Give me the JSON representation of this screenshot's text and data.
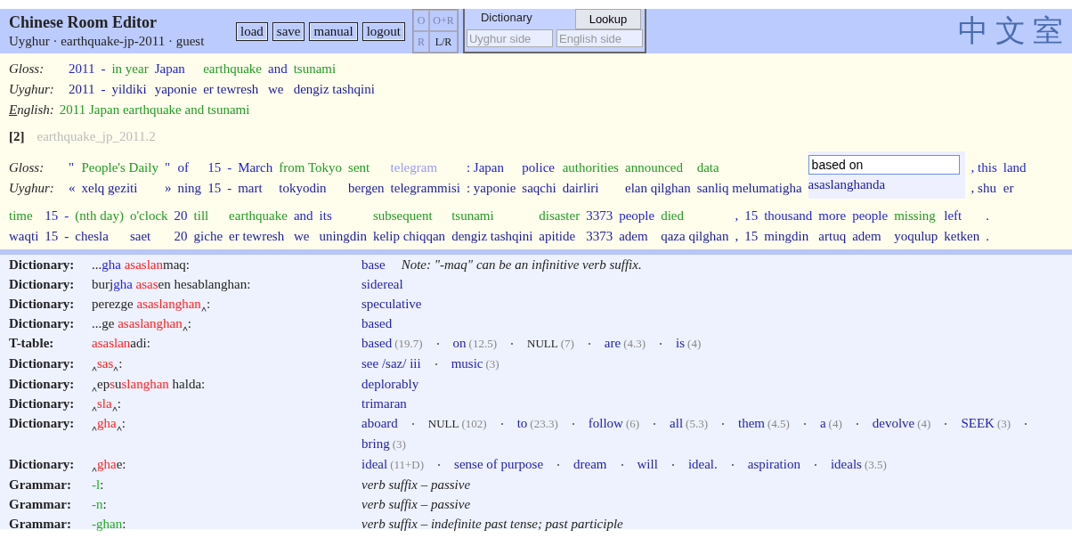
{
  "header": {
    "title": "Chinese Room Editor",
    "subtitle": "Uyghur · earthquake-jp-2011 · guest",
    "buttons": [
      "load",
      "save",
      "manual",
      "logout"
    ],
    "modes": [
      {
        "label": "O",
        "disabled": true
      },
      {
        "label": "O+R",
        "disabled": true
      },
      {
        "label": "R",
        "disabled": true
      },
      {
        "label": "L/R",
        "disabled": false
      }
    ],
    "dictionary_panel": {
      "tab": "Dictionary",
      "button": "Lookup",
      "uyghur_placeholder": "Uyghur side",
      "english_placeholder": "English side"
    },
    "logo": "中文室"
  },
  "sentences": [
    {
      "gloss_label": "Gloss:",
      "uyghur_label": "Uyghur:",
      "english_label": "English:",
      "english": "2011 Japan earthquake and tsunami",
      "rows": [
        {
          "tokens": [
            {
              "gloss": "2011",
              "uyghur": "2011",
              "kind": "dictionary",
              "selected": false
            },
            {
              "gloss": "-",
              "uyghur": "-",
              "kind": "dictionary",
              "selected": false
            },
            {
              "gloss": "in year",
              "uyghur": "yildiki",
              "kind": "confirmed",
              "selected": false
            },
            {
              "gloss": "Japan",
              "uyghur": "yaponie",
              "kind": "dictionary",
              "selected": false
            },
            {
              "gloss": "earthquake",
              "uyghur": "er tewresh",
              "kind": "confirmed",
              "selected": false
            },
            {
              "gloss": "and",
              "uyghur": "we",
              "kind": "dictionary",
              "selected": false
            },
            {
              "gloss": "tsunami",
              "uyghur": "dengiz tashqini",
              "kind": "confirmed",
              "selected": false
            }
          ]
        }
      ]
    },
    {
      "number": "[2]",
      "id": "earthquake_jp_2011.2",
      "gloss_label": "Gloss:",
      "uyghur_label": "Uyghur:",
      "rows": [
        {
          "tokens": [
            {
              "gloss": "\"",
              "uyghur": "«",
              "kind": "dictionary",
              "selected": false
            },
            {
              "gloss": "People's Daily",
              "uyghur": "xelq geziti",
              "kind": "confirmed",
              "selected": false
            },
            {
              "gloss": "\"",
              "uyghur": "»",
              "kind": "dictionary",
              "selected": false
            },
            {
              "gloss": "of",
              "uyghur": "ning",
              "kind": "dictionary",
              "selected": false
            },
            {
              "gloss": "15",
              "uyghur": "15",
              "kind": "dictionary",
              "selected": false
            },
            {
              "gloss": "-",
              "uyghur": "-",
              "kind": "dictionary",
              "selected": false
            },
            {
              "gloss": "March",
              "uyghur": "mart",
              "kind": "dictionary",
              "selected": false
            },
            {
              "gloss": "from Tokyo",
              "uyghur": "tokyodin",
              "kind": "confirmed",
              "selected": false
            },
            {
              "gloss": "sent",
              "uyghur": "bergen",
              "kind": "confirmed",
              "selected": false
            },
            {
              "gloss": "telegram",
              "uyghur": "telegrammisi",
              "kind": "unknown",
              "selected": false
            },
            {
              "gloss": ": Japan",
              "uyghur": ": yaponie",
              "kind": "dictionary",
              "selected": false
            },
            {
              "gloss": "police",
              "uyghur": "saqchi",
              "kind": "dictionary",
              "selected": false
            },
            {
              "gloss": "authorities",
              "uyghur": "dairliri",
              "kind": "confirmed",
              "selected": false
            },
            {
              "gloss": "announced",
              "uyghur": "elan qilghan",
              "kind": "confirmed",
              "selected": false
            },
            {
              "gloss": "data",
              "uyghur": "sanliq melumatigha",
              "kind": "confirmed",
              "selected": false
            },
            {
              "gloss": "based on",
              "uyghur": "asaslanghanda",
              "selected": true
            },
            {
              "gloss": ", this",
              "uyghur": ", shu",
              "kind": "dictionary",
              "selected": false
            },
            {
              "gloss": "land",
              "uyghur": "er",
              "kind": "dictionary",
              "selected": false
            }
          ]
        },
        {
          "tokens": [
            {
              "gloss": "time",
              "uyghur": "waqti",
              "kind": "confirmed",
              "selected": false
            },
            {
              "gloss": "15",
              "uyghur": "15",
              "kind": "dictionary",
              "selected": false
            },
            {
              "gloss": "-",
              "uyghur": "-",
              "kind": "dictionary",
              "selected": false
            },
            {
              "gloss": "(nth day)",
              "uyghur": "chesla",
              "kind": "confirmed",
              "selected": false
            },
            {
              "gloss": "o'clock",
              "uyghur": "saet",
              "kind": "confirmed",
              "selected": false
            },
            {
              "gloss": "20",
              "uyghur": "20",
              "kind": "dictionary",
              "selected": false
            },
            {
              "gloss": "till",
              "uyghur": "giche",
              "kind": "confirmed",
              "selected": false
            },
            {
              "gloss": "earthquake",
              "uyghur": "er tewresh",
              "kind": "confirmed",
              "selected": false
            },
            {
              "gloss": "and",
              "uyghur": "we",
              "kind": "dictionary",
              "selected": false
            },
            {
              "gloss": "its",
              "uyghur": "uningdin",
              "kind": "dictionary",
              "selected": false
            },
            {
              "gloss": "subsequent",
              "uyghur": "kelip chiqqan",
              "kind": "confirmed",
              "selected": false
            },
            {
              "gloss": "tsunami",
              "uyghur": "dengiz tashqini",
              "kind": "confirmed",
              "selected": false
            },
            {
              "gloss": "disaster",
              "uyghur": "apitide",
              "kind": "confirmed",
              "selected": false
            },
            {
              "gloss": "3373",
              "uyghur": "3373",
              "kind": "dictionary",
              "selected": false
            },
            {
              "gloss": "people",
              "uyghur": "adem",
              "kind": "dictionary",
              "selected": false
            },
            {
              "gloss": "died",
              "uyghur": "qaza qilghan",
              "kind": "confirmed",
              "selected": false
            },
            {
              "gloss": ",",
              "uyghur": ",",
              "kind": "dictionary",
              "selected": false
            },
            {
              "gloss": "15",
              "uyghur": "15",
              "kind": "dictionary",
              "selected": false
            },
            {
              "gloss": "thousand",
              "uyghur": "mingdin",
              "kind": "dictionary",
              "selected": false
            },
            {
              "gloss": "more",
              "uyghur": "artuq",
              "kind": "dictionary",
              "selected": false
            },
            {
              "gloss": "people",
              "uyghur": "adem",
              "kind": "dictionary",
              "selected": false
            },
            {
              "gloss": "missing",
              "uyghur": "yoqulup",
              "kind": "confirmed",
              "selected": false
            },
            {
              "gloss": "left",
              "uyghur": "ketken",
              "kind": "dictionary",
              "selected": false
            },
            {
              "gloss": ".",
              "uyghur": ".",
              "kind": "dictionary",
              "selected": false
            }
          ]
        }
      ]
    }
  ],
  "lookup": [
    {
      "source": "Dictionary:",
      "parts": [
        {
          "text": "...",
          "kind": "plain"
        },
        {
          "text": "gha",
          "kind": "context"
        },
        {
          "text": " asaslan",
          "kind": "match"
        },
        {
          "text": "maq:",
          "kind": "plain"
        }
      ],
      "senses": [
        {
          "text": "base",
          "kind": "word"
        }
      ],
      "note": "Note: \"-maq\" can be an infinitive verb suffix."
    },
    {
      "source": "Dictionary:",
      "parts": [
        {
          "text": "burj",
          "kind": "plain"
        },
        {
          "text": "gha",
          "kind": "context"
        },
        {
          "text": " asas",
          "kind": "match"
        },
        {
          "text": "en hesablanghan:",
          "kind": "plain"
        }
      ],
      "senses": [
        {
          "text": "sidereal",
          "kind": "word"
        }
      ]
    },
    {
      "source": "Dictionary:",
      "parts": [
        {
          "text": "perezge ",
          "kind": "plain"
        },
        {
          "text": "asaslanghan",
          "kind": "match"
        },
        {
          "text": "‸:",
          "kind": "plain"
        }
      ],
      "senses": [
        {
          "text": "speculative",
          "kind": "word"
        }
      ]
    },
    {
      "source": "Dictionary:",
      "parts": [
        {
          "text": "...ge ",
          "kind": "plain"
        },
        {
          "text": "asaslanghan",
          "kind": "match"
        },
        {
          "text": "‸:",
          "kind": "plain"
        }
      ],
      "senses": [
        {
          "text": "based",
          "kind": "word"
        }
      ]
    },
    {
      "source": "T-table:",
      "parts": [
        {
          "text": "asaslan",
          "kind": "match"
        },
        {
          "text": "adi:",
          "kind": "plain"
        }
      ],
      "senses": [
        {
          "text": "based",
          "count": "(19.7)",
          "kind": "word"
        },
        {
          "text": "on",
          "count": "(12.5)",
          "kind": "word"
        },
        {
          "text": "NULL",
          "count": "(7)",
          "kind": "null"
        },
        {
          "text": "are",
          "count": "(4.3)",
          "kind": "word"
        },
        {
          "text": "is",
          "count": "(4)",
          "kind": "word"
        }
      ]
    },
    {
      "source": "Dictionary:",
      "parts": [
        {
          "text": "‸",
          "kind": "plain"
        },
        {
          "text": "sas",
          "kind": "match"
        },
        {
          "text": "‸:",
          "kind": "plain"
        }
      ],
      "senses": [
        {
          "text": "see /saz/ iii",
          "kind": "word"
        },
        {
          "text": "music",
          "count": "(3)",
          "kind": "word"
        }
      ]
    },
    {
      "source": "Dictionary:",
      "parts": [
        {
          "text": "‸ep",
          "kind": "plain"
        },
        {
          "text": "s",
          "kind": "match"
        },
        {
          "text": "u",
          "kind": "plain"
        },
        {
          "text": "slanghan",
          "kind": "match"
        },
        {
          "text": " halda:",
          "kind": "plain"
        }
      ],
      "senses": [
        {
          "text": "deplorably",
          "kind": "word"
        }
      ]
    },
    {
      "source": "Dictionary:",
      "parts": [
        {
          "text": "‸",
          "kind": "plain"
        },
        {
          "text": "sla",
          "kind": "match"
        },
        {
          "text": "‸:",
          "kind": "plain"
        }
      ],
      "senses": [
        {
          "text": "trimaran",
          "kind": "word"
        }
      ]
    },
    {
      "source": "Dictionary:",
      "parts": [
        {
          "text": "‸",
          "kind": "plain"
        },
        {
          "text": "gha",
          "kind": "match"
        },
        {
          "text": "‸:",
          "kind": "plain"
        }
      ],
      "senses": [
        {
          "text": "aboard",
          "kind": "word"
        },
        {
          "text": "NULL",
          "count": "(102)",
          "kind": "null"
        },
        {
          "text": "to",
          "count": "(23.3)",
          "kind": "word"
        },
        {
          "text": "follow",
          "count": "(6)",
          "kind": "word"
        },
        {
          "text": "all",
          "count": "(5.3)",
          "kind": "word"
        },
        {
          "text": "them",
          "count": "(4.5)",
          "kind": "word"
        },
        {
          "text": "a",
          "count": "(4)",
          "kind": "word"
        },
        {
          "text": "devolve",
          "count": "(4)",
          "kind": "word"
        },
        {
          "text": "SEEK",
          "count": "(3)",
          "kind": "word"
        },
        {
          "text": "bring",
          "count": "(3)",
          "kind": "word"
        }
      ]
    },
    {
      "source": "Dictionary:",
      "parts": [
        {
          "text": "‸",
          "kind": "plain"
        },
        {
          "text": "gha",
          "kind": "match"
        },
        {
          "text": "e:",
          "kind": "plain"
        }
      ],
      "senses": [
        {
          "text": "ideal",
          "count": "(11+D)",
          "kind": "word"
        },
        {
          "text": "sense of purpose",
          "kind": "word"
        },
        {
          "text": "dream",
          "kind": "word"
        },
        {
          "text": "will",
          "kind": "word"
        },
        {
          "text": "ideal.",
          "kind": "word"
        },
        {
          "text": "aspiration",
          "kind": "word"
        },
        {
          "text": "ideals",
          "count": "(3.5)",
          "kind": "word"
        }
      ]
    },
    {
      "source": "Grammar:",
      "parts": [
        {
          "text": "-l",
          "kind": "suffix"
        },
        {
          "text": ":",
          "kind": "plain"
        }
      ],
      "description": "verb suffix – passive"
    },
    {
      "source": "Grammar:",
      "parts": [
        {
          "text": "-n",
          "kind": "suffix"
        },
        {
          "text": ":",
          "kind": "plain"
        }
      ],
      "description": "verb suffix – passive"
    },
    {
      "source": "Grammar:",
      "parts": [
        {
          "text": "-ghan",
          "kind": "suffix"
        },
        {
          "text": ":",
          "kind": "plain"
        }
      ],
      "description": "verb suffix – indefinite past tense; past participle"
    }
  ]
}
